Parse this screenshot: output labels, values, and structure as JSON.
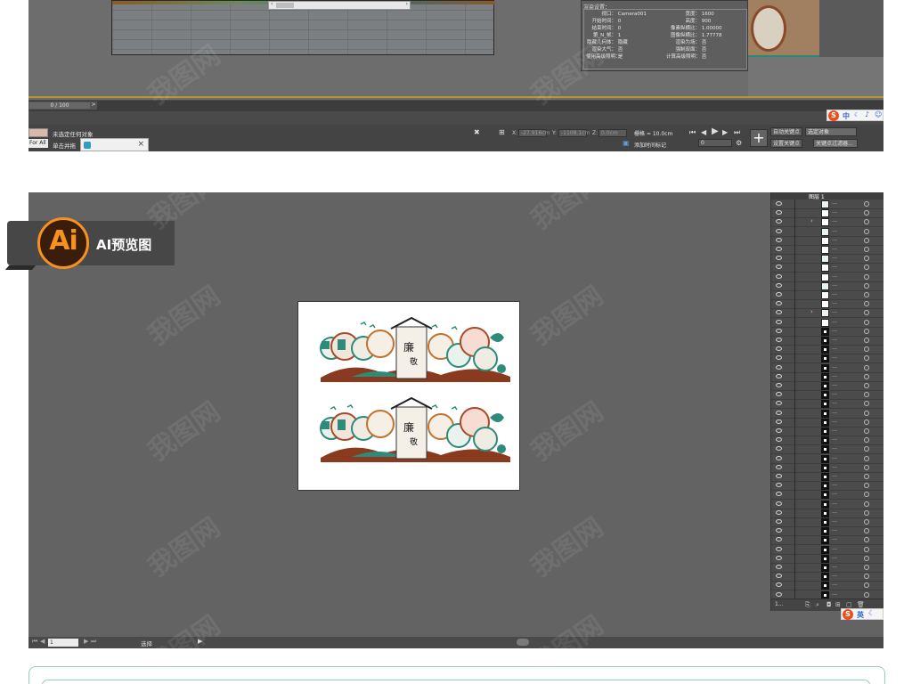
{
  "max": {
    "time_slider": "0 / 100",
    "time_next": ">",
    "status_line1": "未选定任何对象",
    "status_line2": "单击并拖",
    "for_all": "For All",
    "x_label": "X:",
    "x_value": "-27.916cm",
    "y_label": "Y:",
    "y_value": "-1108.1cm",
    "z_label": "Z:",
    "z_value": "0.0cm",
    "grid_label": "栅格 = 10.0cm",
    "add_time_tag": "添加时间标记",
    "auto_key": "自动关键点",
    "set_key": "设置关键点",
    "selected_object": "选定对象",
    "key_filter": "关键点过滤器...",
    "frame_value": "0",
    "render_dialog": {
      "title": "渲染设置：",
      "left_rows": [
        {
          "label": "视口：",
          "value": "Camera001"
        },
        {
          "label": "开始时间：",
          "value": "0"
        },
        {
          "label": "结束时间：",
          "value": "0"
        },
        {
          "label": "第_N_帧：",
          "value": "1"
        },
        {
          "label": "隐藏几何体：",
          "value": "隐藏"
        },
        {
          "label": "渲染大气：",
          "value": "否"
        },
        {
          "label": "使用高级照明：",
          "value": "是"
        }
      ],
      "right_rows": [
        {
          "label": "宽度：",
          "value": "1600"
        },
        {
          "label": "高度：",
          "value": "900"
        },
        {
          "label": "像素纵横比：",
          "value": "1.00000"
        },
        {
          "label": "图像纵横比：",
          "value": "1.77778"
        },
        {
          "label": "渲染为场：",
          "value": "否"
        },
        {
          "label": "强制双面：",
          "value": "否"
        },
        {
          "label": "计算高级照明：",
          "value": "否"
        }
      ]
    },
    "sogou_text": "中"
  },
  "ai_badge": {
    "logo_text": "Ai",
    "label": "AI预览图"
  },
  "ai_panel": {
    "zoom": "1",
    "tool_label": "选择",
    "layers_header": "图层 1",
    "layer_count": "1...",
    "layer_rows_count": 44,
    "sogou_text": "英"
  },
  "watermark": "我图网"
}
